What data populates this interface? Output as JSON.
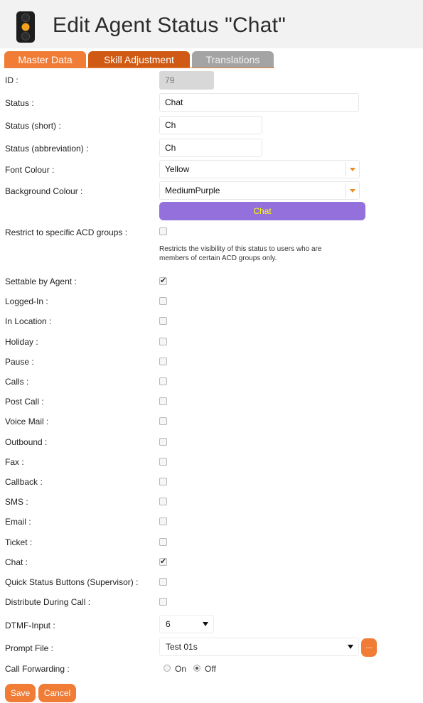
{
  "header": {
    "title": "Edit Agent Status \"Chat\"",
    "icon": "traffic-light-icon"
  },
  "tabs": [
    {
      "label": "Master Data"
    },
    {
      "label": "Skill Adjustment"
    },
    {
      "label": "Translations"
    }
  ],
  "fields": {
    "id": {
      "label": "ID :",
      "value": "79"
    },
    "status": {
      "label": "Status :",
      "value": "Chat"
    },
    "status_short": {
      "label": "Status (short) :",
      "value": "Ch"
    },
    "status_abbr": {
      "label": "Status (abbreviation) :",
      "value": "Ch"
    },
    "font_colour": {
      "label": "Font Colour :",
      "value": "Yellow"
    },
    "background_colour": {
      "label": "Background Colour :",
      "value": "MediumPurple"
    },
    "preview": {
      "text": "Chat",
      "font_color": "#ffff00",
      "background": "#9370db"
    },
    "restrict": {
      "label": "Restrict to specific ACD groups :",
      "checked": false,
      "hint": "Restricts the visibility of this status to users who are members of certain ACD groups only."
    }
  },
  "checkboxes": [
    {
      "label": "Settable by Agent :",
      "checked": true
    },
    {
      "label": "Logged-In :",
      "checked": false
    },
    {
      "label": "In Location :",
      "checked": false
    },
    {
      "label": "Holiday :",
      "checked": false
    },
    {
      "label": "Pause :",
      "checked": false
    },
    {
      "label": "Calls :",
      "checked": false
    },
    {
      "label": "Post Call :",
      "checked": false
    },
    {
      "label": "Voice Mail :",
      "checked": false
    },
    {
      "label": "Outbound :",
      "checked": false
    },
    {
      "label": "Fax :",
      "checked": false
    },
    {
      "label": "Callback :",
      "checked": false
    },
    {
      "label": "SMS :",
      "checked": false
    },
    {
      "label": "Email :",
      "checked": false
    },
    {
      "label": "Ticket :",
      "checked": false
    },
    {
      "label": "Chat :",
      "checked": true
    },
    {
      "label": "Quick Status Buttons (Supervisor) :",
      "checked": false
    },
    {
      "label": "Distribute During Call :",
      "checked": false
    }
  ],
  "dtmf": {
    "label": "DTMF-Input :",
    "value": "6"
  },
  "prompt": {
    "label": "Prompt File :",
    "value": "Test 01s",
    "browse_label": "..."
  },
  "forwarding": {
    "label": "Call Forwarding :",
    "on_label": "On",
    "off_label": "Off",
    "selected": "Off"
  },
  "buttons": {
    "save": "Save",
    "cancel": "Cancel"
  },
  "colors": {
    "accent": "#f07c36",
    "tab_active": "#d05a14",
    "tab_inactive": "#a4a4a4"
  }
}
